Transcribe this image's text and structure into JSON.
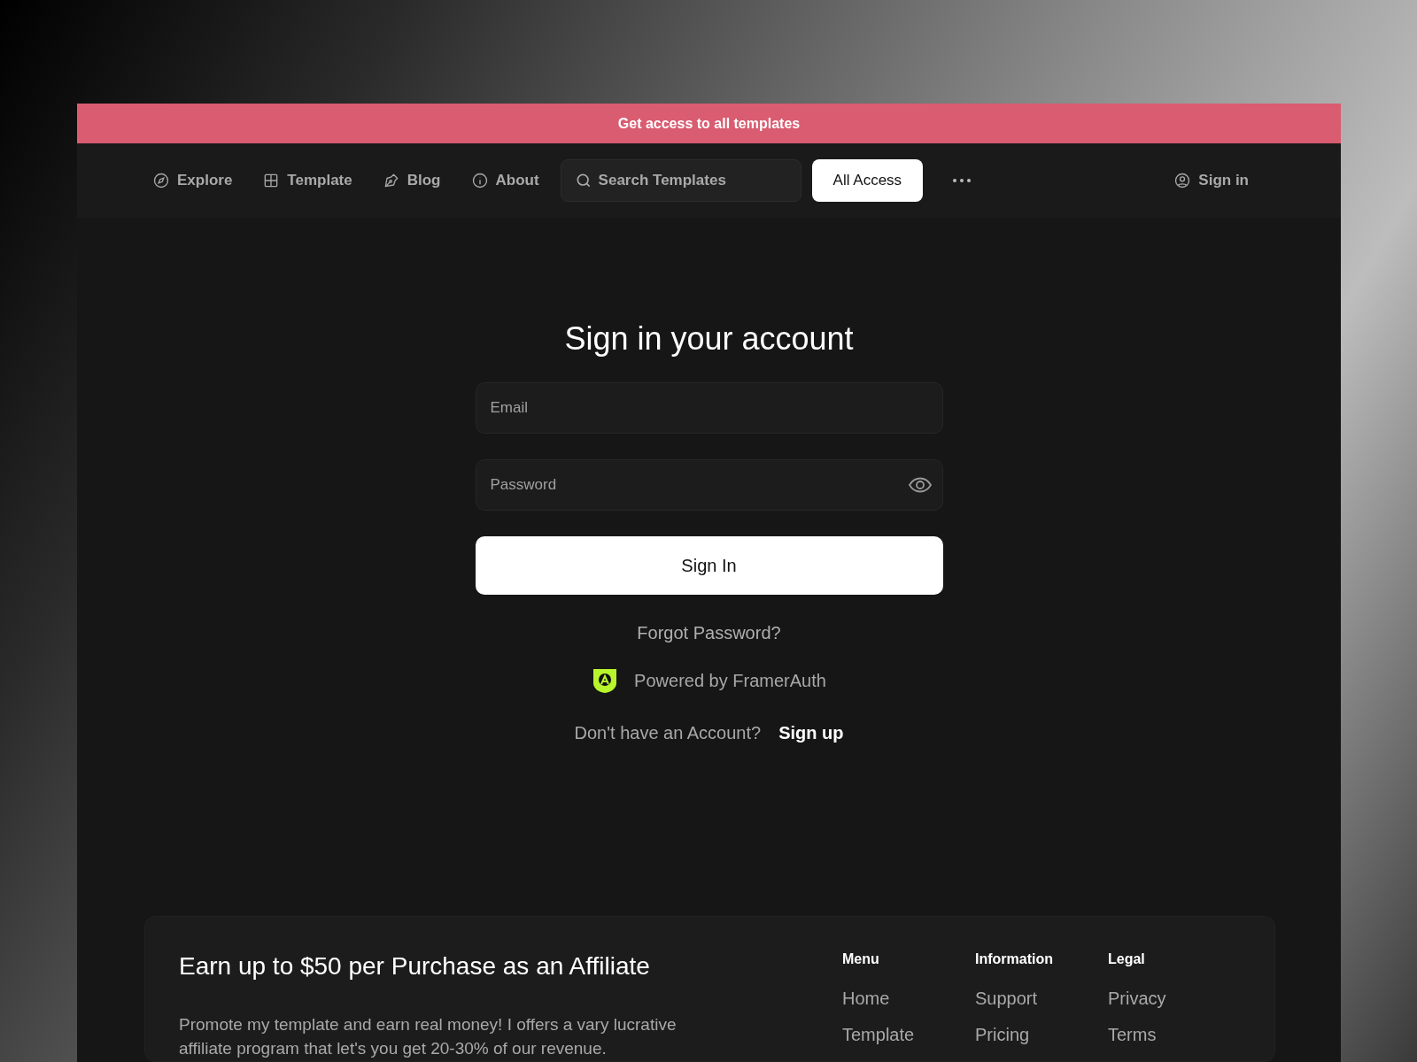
{
  "banner": {
    "text": "Get access to all templates"
  },
  "nav": {
    "items": [
      {
        "label": "Explore",
        "kind": "compass"
      },
      {
        "label": "Template",
        "kind": "grid"
      },
      {
        "label": "Blog",
        "kind": "pen"
      },
      {
        "label": "About",
        "kind": "info"
      }
    ],
    "search": {
      "placeholder": "Search Templates"
    },
    "cta": "All Access",
    "sign_in": "Sign in"
  },
  "form": {
    "title": "Sign in your account",
    "fields": [
      {
        "placeholder": "Email",
        "kind": "email"
      },
      {
        "placeholder": "Password",
        "kind": "password"
      }
    ],
    "submit": "Sign In",
    "forgot": "Forgot Password?",
    "powered": "Powered by FramerAuth",
    "signup_prompt": "Don't have an Account?",
    "signup_link": "Sign up"
  },
  "footer": {
    "heading": "Earn up to $50 per Purchase as an Affiliate",
    "text": "Promote my template and earn real money! I offers a vary lucrative affiliate program that let's you get 20-30% of our revenue.",
    "columns": [
      {
        "title": "Menu",
        "links": [
          "Home",
          "Template"
        ]
      },
      {
        "title": "Information",
        "links": [
          "Support",
          "Pricing"
        ]
      },
      {
        "title": "Legal",
        "links": [
          "Privacy",
          "Terms"
        ]
      }
    ]
  }
}
